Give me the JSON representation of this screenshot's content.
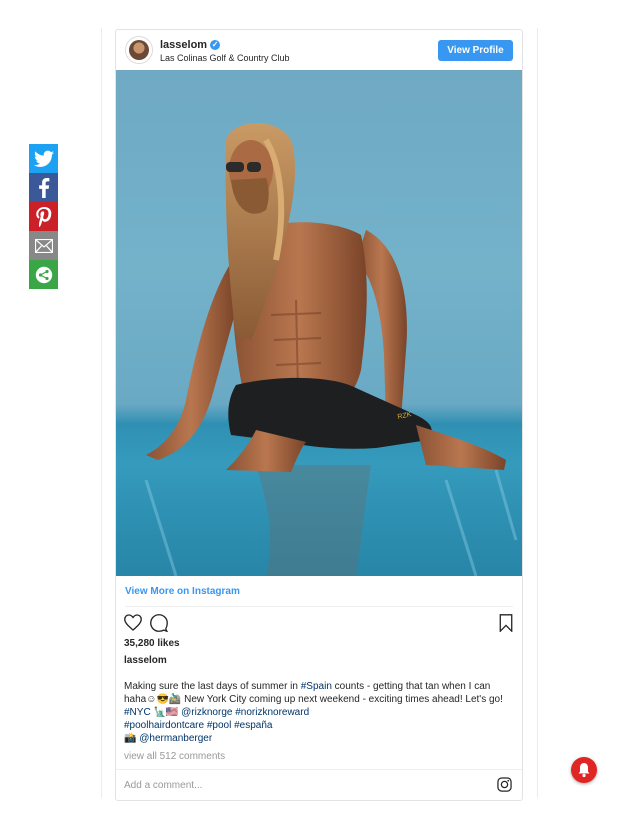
{
  "post": {
    "username": "lasselom",
    "verified_icon": "verified-badge-icon",
    "location": "Las Colinas Golf & Country Club",
    "view_profile_label": "View Profile",
    "view_more_label": "View More on Instagram",
    "likes": "35,280 likes",
    "author": "lasselom",
    "caption": {
      "part1": "Making sure the last days of summer in ",
      "tag_spain": "#Spain",
      "part2": " counts - getting that tan when I can haha☺😎🚵🏼‍♂️ New York City coming up next weekend - exciting times ahead! Let's go! ",
      "tag_nyc": "#NYC",
      "part3": " 🗽🇺🇸 ",
      "tag_line1": "@rizknorge #norizknoreward",
      "tag_line2": "#poolhairdontcare #pool #españa",
      "camera": "📸 ",
      "tag_photographer": "@hermanberger"
    },
    "view_all_comments": "view all 512 comments",
    "add_comment_placeholder": "Add a comment..."
  },
  "icons": {
    "like": "heart-icon",
    "comment": "comment-bubble-icon",
    "save": "bookmark-icon",
    "instagram": "instagram-icon"
  },
  "share_bar": [
    {
      "name": "twitter",
      "icon": "twitter-icon",
      "color": "#1da1f2"
    },
    {
      "name": "facebook",
      "icon": "facebook-icon",
      "color": "#3b5998"
    },
    {
      "name": "pinterest",
      "icon": "pinterest-icon",
      "color": "#cb2027"
    },
    {
      "name": "email",
      "icon": "email-icon",
      "color": "#888888"
    },
    {
      "name": "more",
      "icon": "share-more-icon",
      "color": "#3aa648"
    }
  ],
  "colors": {
    "accent": "#3897f0",
    "hashtag": "#003569",
    "notification": "#e02525"
  }
}
